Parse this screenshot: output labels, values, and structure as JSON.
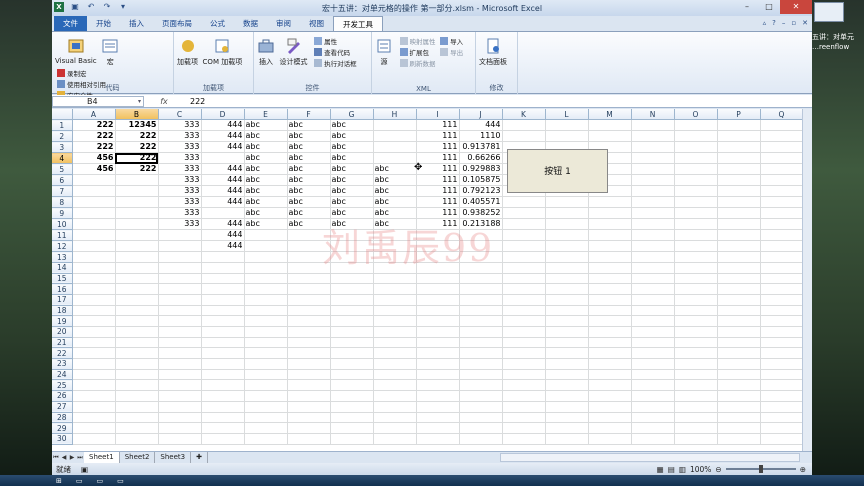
{
  "window": {
    "title": "宏十五讲：对单元格的操作 第一部分.xlsm - Microsoft Excel"
  },
  "ribbon_tabs": [
    "文件",
    "开始",
    "插入",
    "页面布局",
    "公式",
    "数据",
    "审阅",
    "视图",
    "开发工具"
  ],
  "ribbon": {
    "code": {
      "name": "代码",
      "visual_basic": "Visual Basic",
      "macro": "宏",
      "record": "录制宏",
      "relative": "使用相对引用",
      "security": "宏安全性"
    },
    "addins": {
      "name": "加载项",
      "addins": "加载项",
      "com": "COM 加载项"
    },
    "controls": {
      "name": "控件",
      "insert": "插入",
      "design": "设计模式",
      "properties": "属性",
      "view_code": "查看代码",
      "dialog": "执行对话框"
    },
    "xml": {
      "name": "XML",
      "source": "源",
      "map_props": "映射属性",
      "expansion": "扩展包",
      "refresh": "刷新数据",
      "import": "导入",
      "export": "导出"
    },
    "modify": {
      "name": "修改",
      "doc_panel": "文档面板"
    }
  },
  "formula_bar": {
    "name_box": "B4",
    "fx": "fx",
    "value": "222"
  },
  "columns": [
    "A",
    "B",
    "C",
    "D",
    "E",
    "F",
    "G",
    "H",
    "I",
    "J",
    "K",
    "L",
    "M",
    "N",
    "O",
    "P",
    "Q"
  ],
  "rows": [
    [
      "222",
      "12345",
      "333",
      "444",
      "abc",
      "abc",
      "abc",
      "",
      "111",
      "444"
    ],
    [
      "222",
      "222",
      "333",
      "444",
      "abc",
      "abc",
      "abc",
      "",
      "111",
      "1110"
    ],
    [
      "222",
      "222",
      "333",
      "444",
      "abc",
      "abc",
      "abc",
      "",
      "111",
      "0.913781"
    ],
    [
      "456",
      "222",
      "333",
      "",
      "abc",
      "abc",
      "abc",
      "",
      "111",
      "0.66266"
    ],
    [
      "456",
      "222",
      "333",
      "444",
      "abc",
      "abc",
      "abc",
      "abc",
      "111",
      "0.929883"
    ],
    [
      "",
      "",
      "333",
      "444",
      "abc",
      "abc",
      "abc",
      "abc",
      "111",
      "0.105875"
    ],
    [
      "",
      "",
      "333",
      "444",
      "abc",
      "abc",
      "abc",
      "abc",
      "111",
      "0.792123"
    ],
    [
      "",
      "",
      "333",
      "444",
      "abc",
      "abc",
      "abc",
      "abc",
      "111",
      "0.405571"
    ],
    [
      "",
      "",
      "333",
      "",
      "abc",
      "abc",
      "abc",
      "abc",
      "111",
      "0.938252"
    ],
    [
      "",
      "",
      "333",
      "444",
      "abc",
      "abc",
      "abc",
      "abc",
      "111",
      "0.213188"
    ],
    [
      "",
      "",
      "",
      "444",
      "",
      "",
      "",
      "",
      "",
      ""
    ],
    [
      "",
      "",
      "",
      "444",
      "",
      "",
      "",
      "",
      "",
      ""
    ]
  ],
  "row_count": 30,
  "selected_cell": "B4",
  "form_button": "按钮 1",
  "watermark": "刘禹辰99",
  "sheet_tabs": [
    "Sheet1",
    "Sheet2",
    "Sheet3"
  ],
  "status": {
    "ready": "就绪",
    "zoom": "100%"
  },
  "side_text": "五讲：对单元\n…reenflow"
}
